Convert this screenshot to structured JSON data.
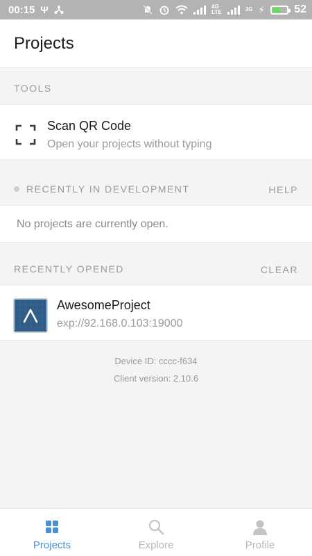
{
  "status_bar": {
    "time": "00:15",
    "battery_level": "52",
    "network_tag_4g": "4G",
    "network_tag_lte": "LTE",
    "network_tag_3g": "3G"
  },
  "header": {
    "title": "Projects"
  },
  "tools": {
    "section_label": "TOOLS",
    "scan": {
      "title": "Scan QR Code",
      "subtitle": "Open your projects without typing"
    }
  },
  "recently_in_development": {
    "section_label": "RECENTLY IN DEVELOPMENT",
    "action": "HELP",
    "empty_text": "No projects are currently open."
  },
  "recently_opened": {
    "section_label": "RECENTLY OPENED",
    "action": "CLEAR",
    "projects": [
      {
        "name": "AwesomeProject",
        "url": "exp://92.168.0.103:19000"
      }
    ]
  },
  "device_info": {
    "device_id": "Device ID: cccc-f634",
    "client_version": "Client version: 2.10.6"
  },
  "tab_bar": {
    "tabs": [
      {
        "label": "Projects",
        "icon": "grid-icon",
        "active": true
      },
      {
        "label": "Explore",
        "icon": "search-icon",
        "active": false
      },
      {
        "label": "Profile",
        "icon": "person-icon",
        "active": false
      }
    ]
  },
  "colors": {
    "accent": "#4a90d9",
    "status_bar": "#b3b3b3",
    "battery": "#5ee05e",
    "project_thumb": "#2f5d87"
  }
}
